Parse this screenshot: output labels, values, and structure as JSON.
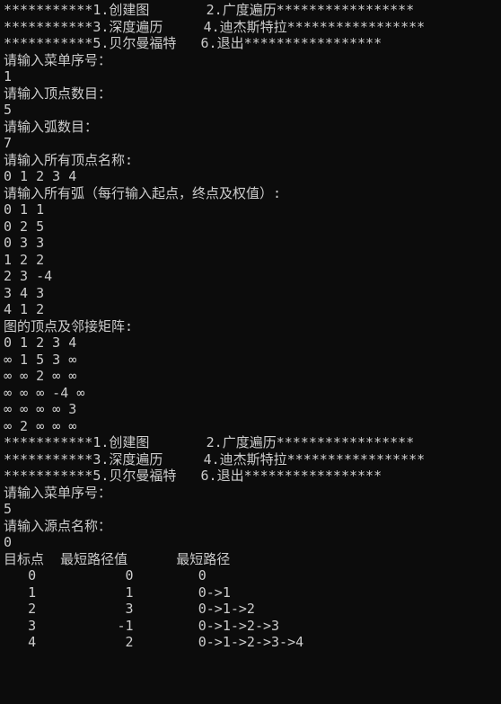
{
  "menu": {
    "stars": "***********",
    "stars_tail": "*****************",
    "items": [
      {
        "num": "1",
        "label": "创建图"
      },
      {
        "num": "2",
        "label": "广度遍历"
      },
      {
        "num": "3",
        "label": "深度遍历"
      },
      {
        "num": "4",
        "label": "迪杰斯特拉"
      },
      {
        "num": "5",
        "label": "贝尔曼福特"
      },
      {
        "num": "6",
        "label": "退出"
      }
    ]
  },
  "prompts": {
    "enter_menu": "请输入菜单序号：",
    "enter_menu_val_1": "1",
    "enter_vertex_count": "请输入顶点数目：",
    "vertex_count_val": "5",
    "enter_arc_count": "请输入弧数目：",
    "arc_count_val": "7",
    "enter_vertex_names": "请输入所有顶点名称:",
    "vertex_names_val": "0 1 2 3 4",
    "enter_arcs": "请输入所有弧（每行输入起点，终点及权值）:",
    "arcs": [
      "0 1 1",
      "0 2 5",
      "0 3 3",
      "1 2 2",
      "2 3 -4",
      "3 4 3",
      "4 1 2"
    ],
    "vertices_and_matrix": "图的顶点及邻接矩阵:",
    "matrix_header": "0 1 2 3 4",
    "matrix_rows": [
      "∞ 1 5 3 ∞",
      "∞ ∞ 2 ∞ ∞",
      "∞ ∞ ∞ -4 ∞",
      "∞ ∞ ∞ ∞ 3",
      "∞ 2 ∞ ∞ ∞"
    ],
    "enter_menu_val_2": "5",
    "enter_source": "请输入源点名称：",
    "source_val": "0"
  },
  "result": {
    "header_dest": "目标点",
    "header_dist": "最短路径值",
    "header_path": "最短路径",
    "rows": [
      {
        "dest": "0",
        "dist": "0",
        "path": "0"
      },
      {
        "dest": "1",
        "dist": "1",
        "path": "0->1"
      },
      {
        "dest": "2",
        "dist": "3",
        "path": "0->1->2"
      },
      {
        "dest": "3",
        "dist": "-1",
        "path": "0->1->2->3"
      },
      {
        "dest": "4",
        "dist": "2",
        "path": "0->1->2->3->4"
      }
    ]
  }
}
